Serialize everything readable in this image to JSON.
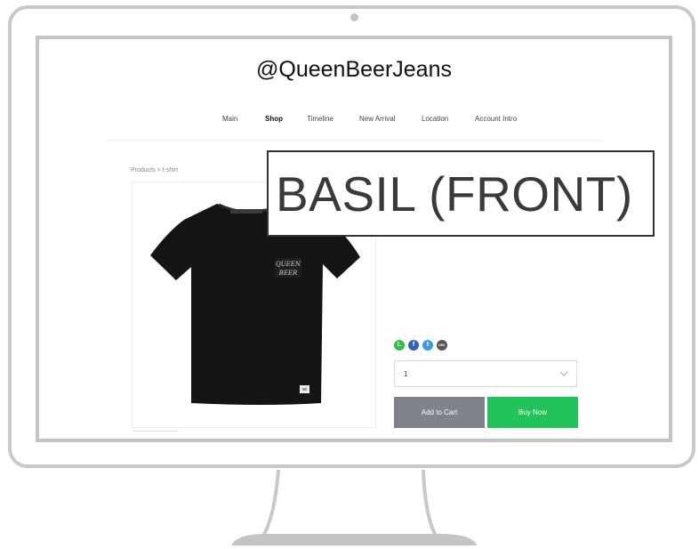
{
  "site": {
    "title": "@QueenBeerJeans"
  },
  "nav": {
    "items": [
      {
        "label": "Main"
      },
      {
        "label": "Shop"
      },
      {
        "label": "Timeline"
      },
      {
        "label": "New Arrival"
      },
      {
        "label": "Location"
      },
      {
        "label": "Account Intro"
      }
    ],
    "active": "Shop"
  },
  "breadcrumb": {
    "text": "Products > t-shirt"
  },
  "product": {
    "name_zoom": "BASIL (FRONT)",
    "tshirt_logo_text": "QUEEN BEER",
    "share_icons": [
      {
        "icon": "line-icon",
        "glyph": "L",
        "color": "#2fbf4a"
      },
      {
        "icon": "facebook-icon",
        "glyph": "f",
        "color": "#2f5fb6"
      },
      {
        "icon": "twitter-icon",
        "glyph": "t",
        "color": "#3b9ae6"
      },
      {
        "icon": "link-icon",
        "glyph": "URL",
        "color": "#555555"
      }
    ],
    "quantity": "1",
    "add_to_cart_label": "Add to Cart",
    "buy_now_label": "Buy Now"
  },
  "colors": {
    "buy_now": "#22c35a",
    "add_to_cart": "#7f8288",
    "monitor_frame": "#c9c9c9"
  }
}
